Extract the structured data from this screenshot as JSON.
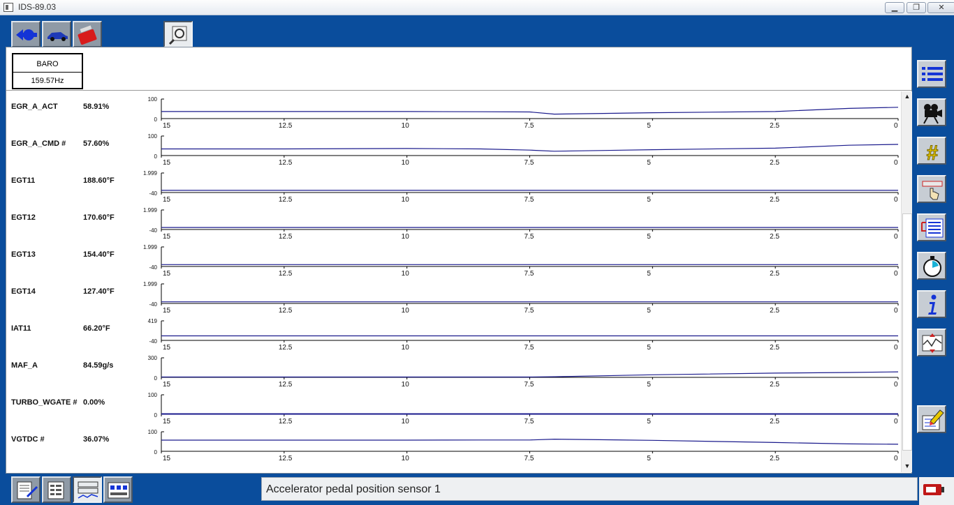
{
  "window": {
    "title": "IDS-89.03",
    "min_label": "▁",
    "max_label": "❐",
    "close_label": "✕"
  },
  "toolbar": {
    "buttons": [
      {
        "icon": "back-arrow-icon"
      },
      {
        "icon": "vehicle-icon"
      },
      {
        "icon": "toolbox-icon"
      },
      {
        "icon": "datalogger-icon"
      }
    ]
  },
  "baro": {
    "name": "BARO",
    "value": "159.57Hz"
  },
  "x_ticks": [
    "15",
    "12.5",
    "10",
    "7.5",
    "5",
    "2.5",
    "0"
  ],
  "channels": [
    {
      "name": "EGR_A_ACT",
      "value": "58.91%",
      "ymax": "100",
      "ymin": "0"
    },
    {
      "name": "EGR_A_CMD #",
      "value": "57.60%",
      "ymax": "100",
      "ymin": "0"
    },
    {
      "name": "EGT11",
      "value": "188.60°F",
      "ymax": "1.999",
      "ymin": "-40"
    },
    {
      "name": "EGT12",
      "value": "170.60°F",
      "ymax": "1.999",
      "ymin": "-40"
    },
    {
      "name": "EGT13",
      "value": "154.40°F",
      "ymax": "1.999",
      "ymin": "-40"
    },
    {
      "name": "EGT14",
      "value": "127.40°F",
      "ymax": "1.999",
      "ymin": "-40"
    },
    {
      "name": "IAT11",
      "value": "66.20°F",
      "ymax": "419",
      "ymin": "-40"
    },
    {
      "name": "MAF_A",
      "value": "84.59g/s",
      "ymax": "300",
      "ymin": "0"
    },
    {
      "name": "TURBO_WGATE #",
      "value": "0.00%",
      "ymax": "100",
      "ymin": "0"
    },
    {
      "name": "VGTDC #",
      "value": "36.07%",
      "ymax": "100",
      "ymin": "0"
    }
  ],
  "chart_data": {
    "type": "line",
    "xlabel": "",
    "ylabel": "",
    "x_range": [
      15,
      0
    ],
    "x": [
      15,
      12.5,
      10,
      8.5,
      7.5,
      7,
      5,
      2.5,
      1,
      0
    ],
    "series": [
      {
        "name": "EGR_A_ACT",
        "ylim": [
          0,
          100
        ],
        "values": [
          36,
          36,
          36,
          35,
          34,
          23,
          30,
          36,
          52,
          58
        ]
      },
      {
        "name": "EGR_A_CMD #",
        "ylim": [
          0,
          100
        ],
        "values": [
          34,
          34,
          36,
          34,
          28,
          22,
          30,
          38,
          53,
          57
        ]
      },
      {
        "name": "EGT11",
        "ylim": [
          -40,
          1999
        ],
        "values": [
          188,
          188,
          188,
          188,
          188,
          188,
          188,
          188,
          188,
          188
        ]
      },
      {
        "name": "EGT12",
        "ylim": [
          -40,
          1999
        ],
        "values": [
          172,
          172,
          172,
          172,
          172,
          172,
          172,
          170,
          170,
          170
        ]
      },
      {
        "name": "EGT13",
        "ylim": [
          -40,
          1999
        ],
        "values": [
          158,
          156,
          156,
          156,
          156,
          156,
          155,
          155,
          154,
          154
        ]
      },
      {
        "name": "EGT14",
        "ylim": [
          -40,
          1999
        ],
        "values": [
          128,
          128,
          128,
          128,
          128,
          128,
          128,
          127,
          127,
          127
        ]
      },
      {
        "name": "IAT11",
        "ylim": [
          -40,
          419
        ],
        "values": [
          66,
          66,
          66,
          66,
          66,
          66,
          66,
          66,
          66,
          66
        ]
      },
      {
        "name": "MAF_A",
        "ylim": [
          0,
          300
        ],
        "values": [
          0,
          0,
          0,
          0,
          0,
          10,
          40,
          65,
          75,
          85
        ]
      },
      {
        "name": "TURBO_WGATE #",
        "ylim": [
          0,
          100
        ],
        "values": [
          0,
          0,
          0,
          0,
          0,
          0,
          0,
          0,
          0,
          0
        ]
      },
      {
        "name": "VGTDC #",
        "ylim": [
          0,
          100
        ],
        "values": [
          57,
          57,
          57,
          58,
          58,
          62,
          56,
          45,
          38,
          36
        ]
      }
    ]
  },
  "side_toolbar": [
    {
      "icon": "list-icon"
    },
    {
      "icon": "camera-icon"
    },
    {
      "icon": "hash-icon"
    },
    {
      "icon": "trigger-icon"
    },
    {
      "icon": "select-list-icon"
    },
    {
      "icon": "stopwatch-icon"
    },
    {
      "icon": "info-icon"
    },
    {
      "icon": "graph-scale-icon"
    },
    {
      "icon": "erase-icon"
    }
  ],
  "bottom_toolbar": [
    {
      "icon": "report-icon"
    },
    {
      "icon": "pid-list-icon"
    },
    {
      "icon": "graph-view-icon"
    },
    {
      "icon": "recorder-icon"
    }
  ],
  "status": {
    "text": "Accelerator pedal position sensor 1"
  },
  "colors": {
    "trace": "#1a1a8c",
    "accent_blue": "#0a4d9c",
    "icon_yellow": "#e8c800"
  }
}
